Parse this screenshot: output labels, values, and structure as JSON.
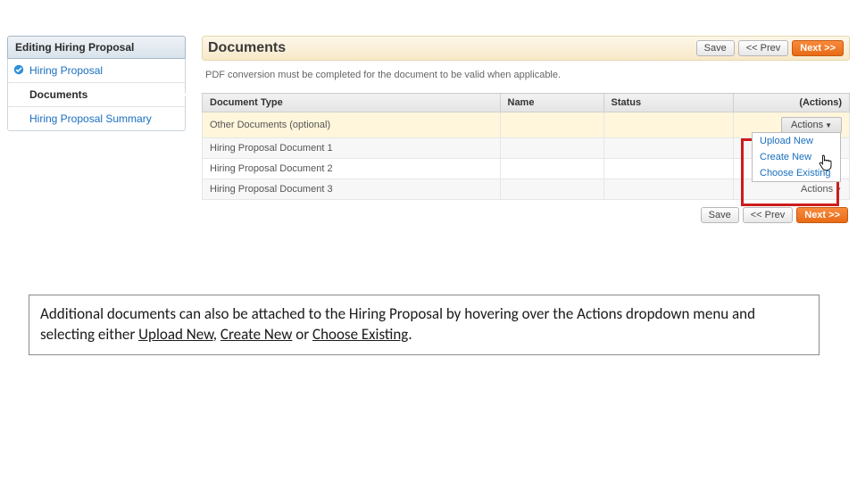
{
  "sidebar": {
    "title": "Editing Hiring Proposal",
    "items": [
      {
        "label": "Hiring Proposal",
        "checked": true,
        "active": false
      },
      {
        "label": "Documents",
        "checked": false,
        "active": true
      },
      {
        "label": "Hiring Proposal Summary",
        "checked": false,
        "active": false
      }
    ]
  },
  "header": {
    "title": "Documents",
    "save": "Save",
    "prev": "<< Prev",
    "next": "Next >>"
  },
  "instruction": "PDF conversion must be completed for the document to be valid when applicable.",
  "table": {
    "cols": {
      "type": "Document Type",
      "name": "Name",
      "status": "Status",
      "actions": "(Actions)"
    },
    "rows": [
      {
        "type": "Other Documents (optional)"
      },
      {
        "type": "Hiring Proposal Document 1"
      },
      {
        "type": "Hiring Proposal Document 2"
      },
      {
        "type": "Hiring Proposal Document 3"
      }
    ],
    "row_action_label": "Actions"
  },
  "actions_menu": {
    "button": "Actions",
    "items": [
      "Upload New",
      "Create New",
      "Choose Existing"
    ]
  },
  "footer": {
    "save": "Save",
    "prev": "<< Prev",
    "next": "Next >>"
  },
  "caption": {
    "pre": "Additional documents can also be attached to the Hiring Proposal by hovering over the Actions dropdown menu and selecting either ",
    "u1": "Upload New",
    "sep1": ", ",
    "u2": "Create New",
    "sep2": " or ",
    "u3": "Choose Existing",
    "end": "."
  }
}
